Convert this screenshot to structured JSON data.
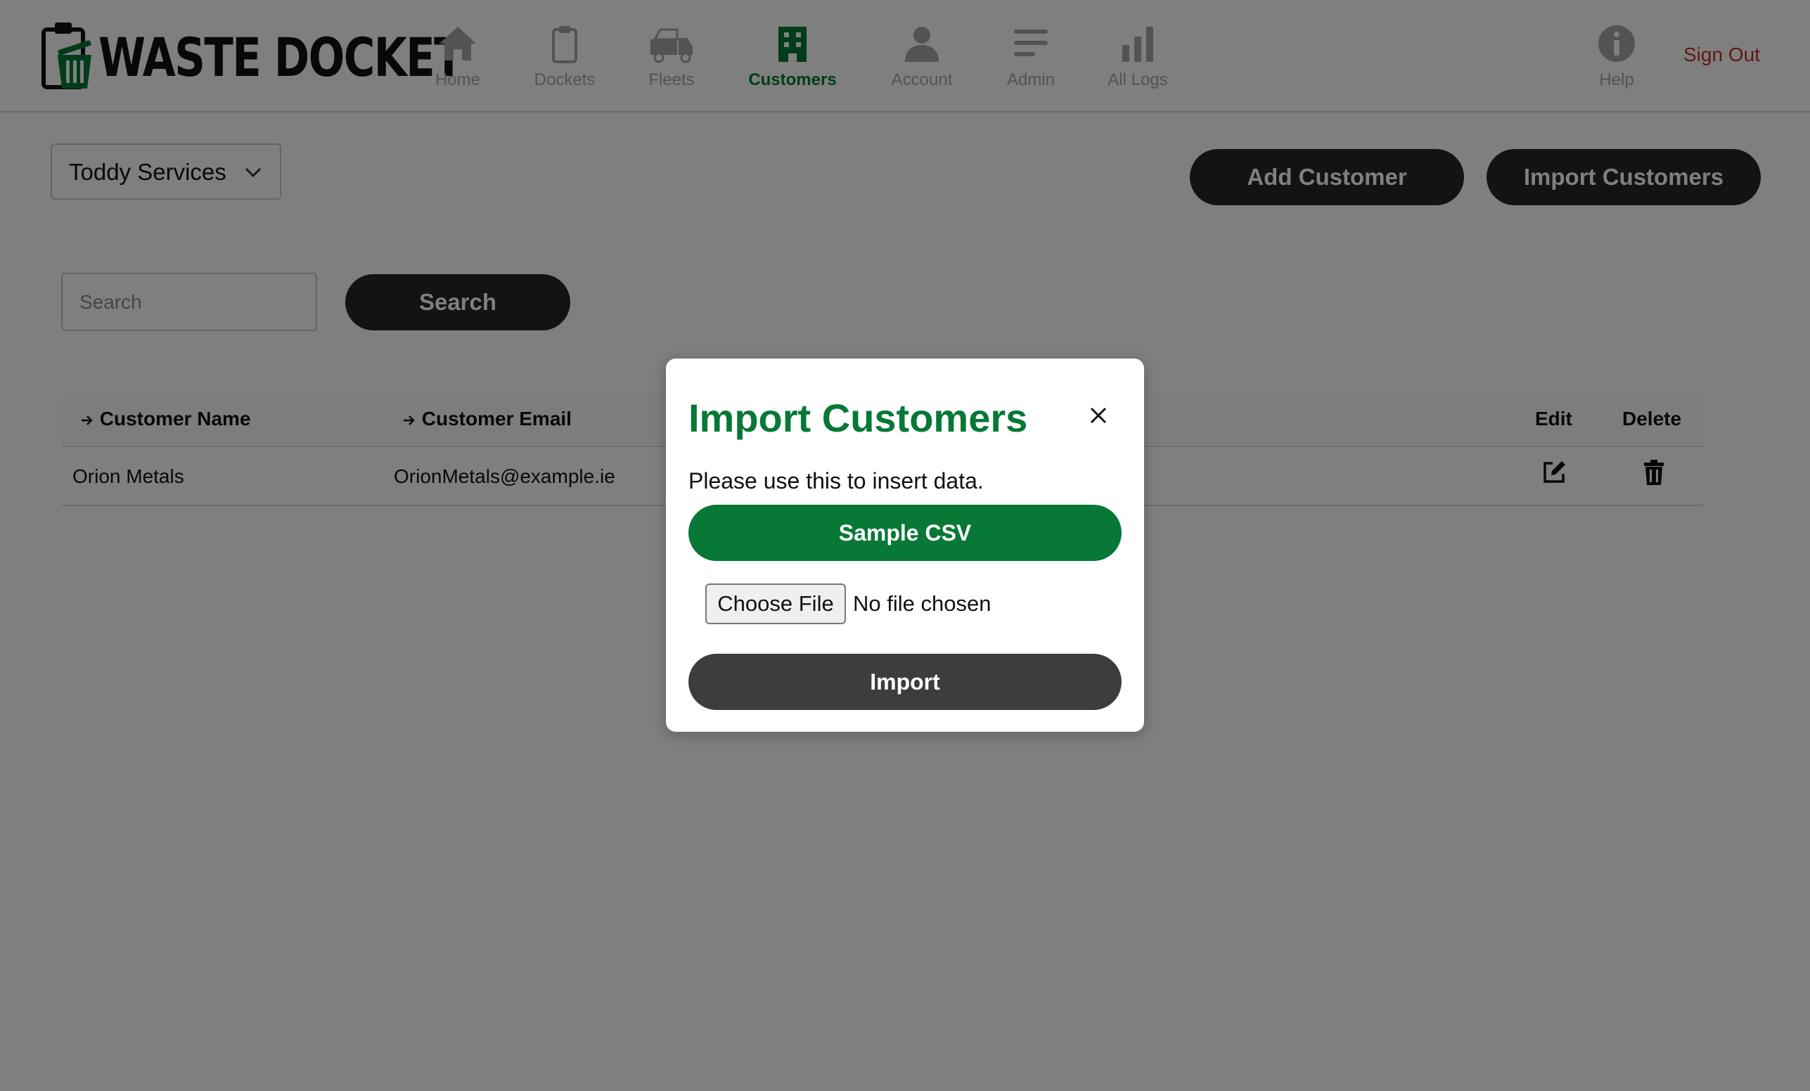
{
  "app": {
    "logo_text": "WASTE DOCKET"
  },
  "nav": {
    "items": [
      {
        "label": "Home",
        "icon": "home-icon"
      },
      {
        "label": "Dockets",
        "icon": "clipboard-icon"
      },
      {
        "label": "Fleets",
        "icon": "truck-icon"
      },
      {
        "label": "Customers",
        "icon": "building-icon",
        "active": true
      },
      {
        "label": "Account",
        "icon": "user-icon"
      },
      {
        "label": "Admin",
        "icon": "menu-lines-icon"
      },
      {
        "label": "All Logs",
        "icon": "bar-chart-icon"
      }
    ],
    "help_label": "Help",
    "sign_out": "Sign Out",
    "active_color": "#077836",
    "inactive_color": "#a7a7a7"
  },
  "toolbar": {
    "company_select": "Toddy Services",
    "add_customer": "Add Customer",
    "import_customers": "Import Customers"
  },
  "search": {
    "placeholder": "Search",
    "button": "Search"
  },
  "table": {
    "columns": {
      "name": "Customer Name",
      "email": "Customer Email",
      "edit": "Edit",
      "delete": "Delete"
    },
    "rows": [
      {
        "name": "Orion Metals",
        "email": "OrionMetals@example.ie"
      }
    ]
  },
  "modal": {
    "title": "Import Customers",
    "text": "Please use this to insert data.",
    "sample_button": "Sample CSV",
    "choose_file": "Choose File",
    "file_status": "No file chosen",
    "import_button": "Import"
  },
  "colors": {
    "brand_green": "#077836",
    "sign_out_red": "#c4302b",
    "dark_button": "#272727",
    "overlay": "rgba(0,0,0,0.5)"
  }
}
